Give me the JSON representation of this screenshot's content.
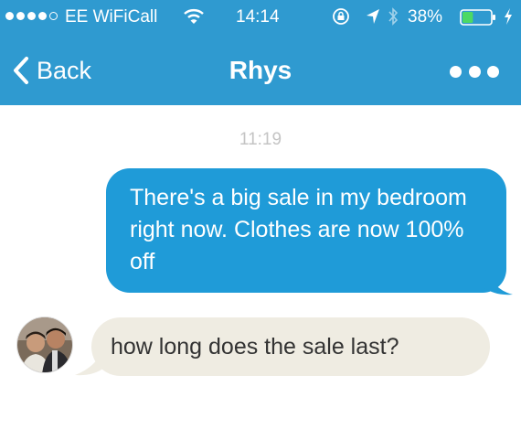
{
  "status_bar": {
    "carrier": "EE WiFiCall",
    "time": "14:14",
    "battery_percent": "38%",
    "battery_level": 0.38,
    "signal_bars_filled": 4,
    "signal_bars_total": 5,
    "icons": [
      "wifi-icon",
      "rotation-lock-icon",
      "location-arrow-icon",
      "bluetooth-icon",
      "battery-icon",
      "charging-bolt-icon"
    ]
  },
  "nav": {
    "back_label": "Back",
    "title": "Rhys",
    "more_icon": "more-dots-icon"
  },
  "conversation": {
    "timestamp": "11:19",
    "messages": [
      {
        "direction": "outgoing",
        "text": "There's a big sale in my bedroom right now. Clothes are now 100% off"
      },
      {
        "direction": "incoming",
        "text": "how long does the sale last?"
      }
    ]
  },
  "colors": {
    "header": "#2f9ad0",
    "outgoing_bubble": "#1f9bd8",
    "incoming_bubble": "#efece2",
    "timestamp": "#c4c4c4"
  }
}
